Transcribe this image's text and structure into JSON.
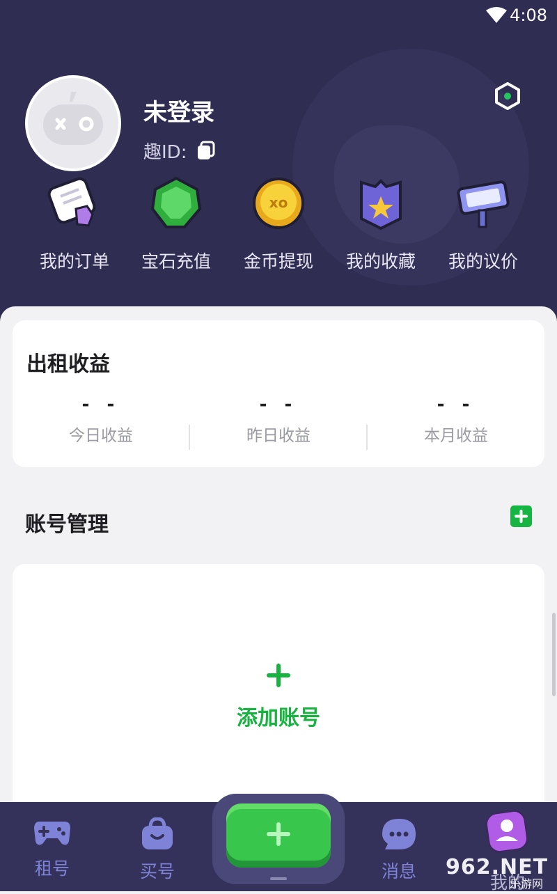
{
  "status_bar": {
    "time": "4:08"
  },
  "profile": {
    "username": "未登录",
    "id_label": "趣ID:"
  },
  "quick_actions": [
    {
      "label": "我的订单",
      "icon": "order-icon"
    },
    {
      "label": "宝石充值",
      "icon": "gem-icon"
    },
    {
      "label": "金币提现",
      "icon": "coin-icon"
    },
    {
      "label": "我的收藏",
      "icon": "favorite-icon"
    },
    {
      "label": "我的议价",
      "icon": "price-sign-icon"
    }
  ],
  "earnings": {
    "title": "出租收益",
    "items": [
      {
        "value": "- -",
        "label": "今日收益"
      },
      {
        "value": "- -",
        "label": "昨日收益"
      },
      {
        "value": "- -",
        "label": "本月收益"
      }
    ]
  },
  "accounts": {
    "title": "账号管理",
    "add_label": "添加账号"
  },
  "bottom_nav": {
    "items": [
      {
        "label": "租号",
        "icon": "gamepad-icon"
      },
      {
        "label": "买号",
        "icon": "shopping-bag-icon"
      },
      {
        "label": "消息",
        "icon": "chat-icon"
      },
      {
        "label": "我的",
        "icon": "profile-icon"
      }
    ]
  },
  "watermark": {
    "main": "962.NET",
    "sub": "乐游网"
  },
  "colors": {
    "header_bg": "#2f2d52",
    "accent_green": "#16b543",
    "nav_icon": "#7e83d8"
  }
}
